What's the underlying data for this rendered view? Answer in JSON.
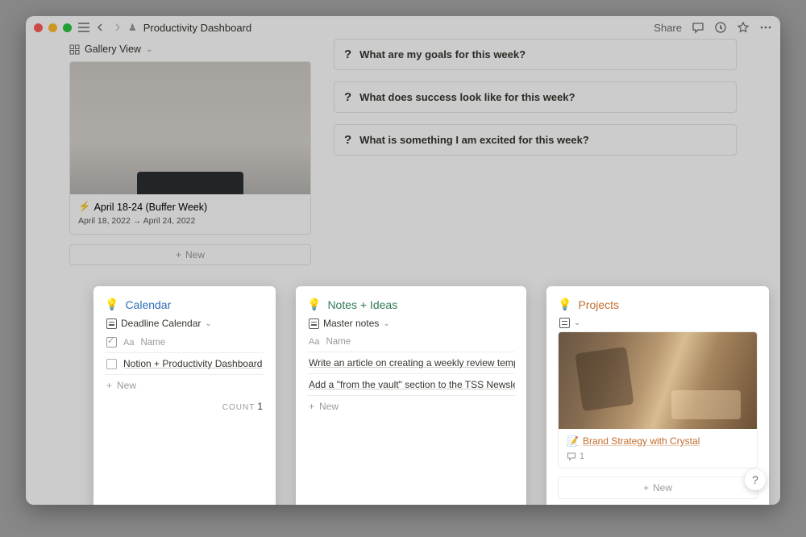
{
  "page": {
    "title": "Productivity Dashboard",
    "share": "Share"
  },
  "gallery": {
    "viewLabel": "Gallery View",
    "card": {
      "emoji": "⚡",
      "title": "April 18-24 (Buffer Week)",
      "dateStart": "April 18, 2022",
      "dateEnd": "April 24, 2022"
    },
    "new": "New"
  },
  "questions": {
    "q1": "What are my goals for this week?",
    "q2": "What does success look like for this week?",
    "q3": "What is something I am excited for this week?"
  },
  "calendar": {
    "bulb": "💡",
    "title": "Calendar",
    "view": "Deadline Calendar",
    "nameCol": "Name",
    "item1": "Notion + Productivity Dashboard",
    "new": "New",
    "countLabel": "COUNT",
    "countValue": "1"
  },
  "notes": {
    "bulb": "💡",
    "title": "Notes + Ideas",
    "view": "Master notes",
    "nameCol": "Name",
    "item1": "Write an article on creating a weekly review template",
    "item2": "Add a \"from the vault\" section to the TSS Newsletter - feature",
    "new": "New"
  },
  "projects": {
    "bulb": "💡",
    "title": "Projects",
    "card": {
      "emoji": "📝",
      "title": "Brand Strategy with Crystal",
      "comments": "1"
    },
    "new": "New"
  }
}
